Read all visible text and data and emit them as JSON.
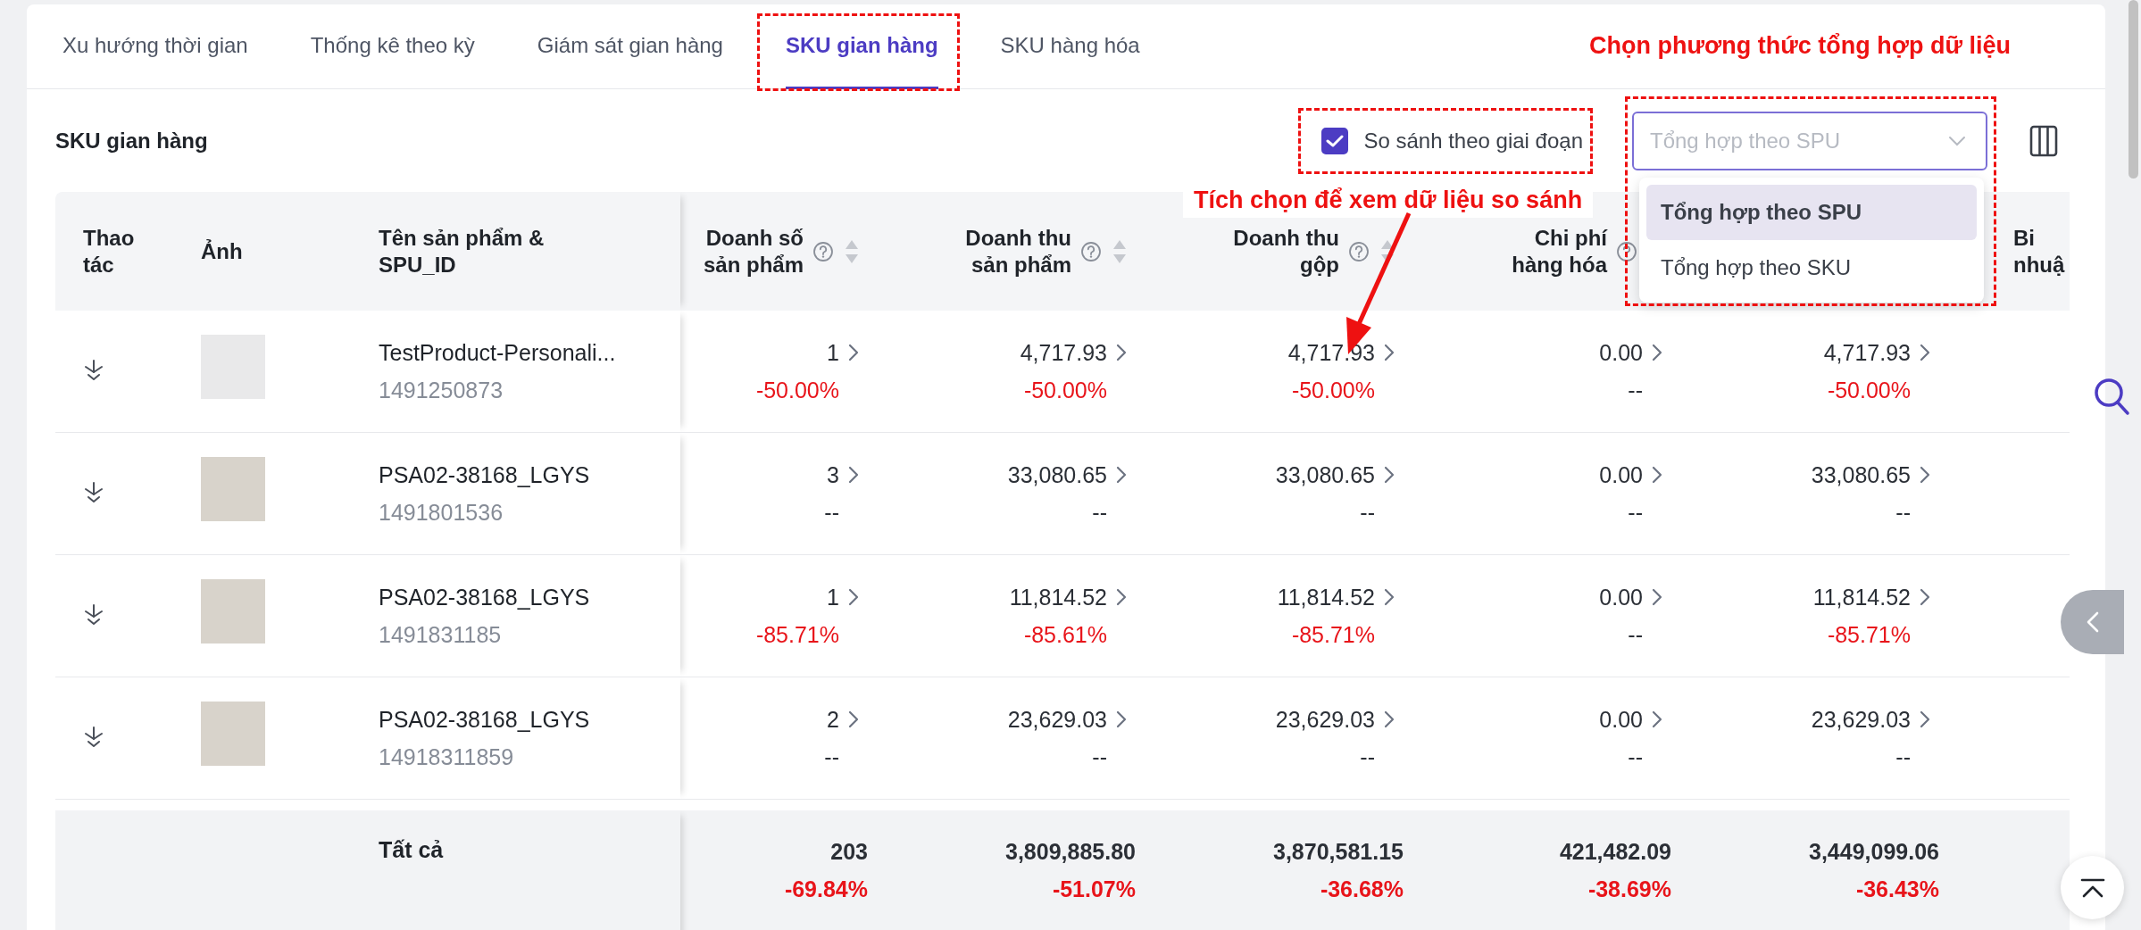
{
  "tabs": [
    {
      "label": "Xu hướng thời gian",
      "selected": false,
      "highlighted": false
    },
    {
      "label": "Thống kê theo kỳ",
      "selected": false,
      "highlighted": false
    },
    {
      "label": "Giám sát gian hàng",
      "selected": false,
      "highlighted": false
    },
    {
      "label": "SKU gian hàng",
      "selected": true,
      "highlighted": true
    },
    {
      "label": "SKU hàng hóa",
      "selected": false,
      "highlighted": false
    }
  ],
  "annotations": {
    "select_hint": "Chọn phương thức tổng hợp dữ liệu",
    "checkbox_hint": "Tích chọn để xem dữ liệu so sánh"
  },
  "toolbar": {
    "title": "SKU gian hàng",
    "compare": {
      "label": "So sánh theo giai đoạn",
      "checked": true,
      "highlighted": true
    },
    "aggregate": {
      "value": "Tổng hợp theo SPU",
      "open": true,
      "highlighted": true,
      "options": [
        {
          "label": "Tổng hợp theo SPU",
          "selected": true
        },
        {
          "label": "Tổng hợp theo SKU",
          "selected": false
        }
      ]
    }
  },
  "table": {
    "columns": [
      {
        "kind": "action",
        "label": "Thao\ntác"
      },
      {
        "kind": "image",
        "label": "Ảnh"
      },
      {
        "kind": "name",
        "label": "Tên sản phẩm &\nSPU_ID"
      },
      {
        "kind": "metric",
        "label": "Doanh số\nsản phẩm",
        "help": true,
        "sortable": true
      },
      {
        "kind": "metric",
        "label": "Doanh thu\nsản phẩm",
        "help": true,
        "sortable": true
      },
      {
        "kind": "metric",
        "label": "Doanh thu\ngộp",
        "help": true,
        "sortable": true
      },
      {
        "kind": "metric",
        "label": "Chi phí\nhàng hóa",
        "help": true,
        "sortable": false
      },
      {
        "kind": "metric"
      },
      {
        "kind": "cut",
        "label": "Bi\nnhuậ"
      }
    ],
    "rows": [
      {
        "cells": [
          "",
          "",
          {
            "name": "TestProduct-Personali...",
            "id": "1491250873"
          },
          {
            "value": "1",
            "change": "-50.00%",
            "color": "#e8141a"
          },
          {
            "value": "4,717.93",
            "change": "-50.00%",
            "color": "#e8141a"
          },
          {
            "value": "4,717.93",
            "change": "-50.00%",
            "color": "#e8141a"
          },
          {
            "value": "0.00",
            "change": "--",
            "color": "#2b2f36"
          },
          {
            "value": "4,717.93",
            "change": "-50.00%",
            "color": "#e8141a"
          },
          ""
        ]
      },
      {
        "cells": [
          "",
          "",
          {
            "name": "PSA02-38168_LGYS",
            "id": "1491801536"
          },
          {
            "value": "3",
            "change": "--",
            "color": "#2b2f36"
          },
          {
            "value": "33,080.65",
            "change": "--",
            "color": "#2b2f36"
          },
          {
            "value": "33,080.65",
            "change": "--",
            "color": "#2b2f36"
          },
          {
            "value": "0.00",
            "change": "--",
            "color": "#2b2f36"
          },
          {
            "value": "33,080.65",
            "change": "--",
            "color": "#2b2f36"
          },
          ""
        ]
      },
      {
        "cells": [
          "",
          "",
          {
            "name": "PSA02-38168_LGYS",
            "id": "1491831185"
          },
          {
            "value": "1",
            "change": "-85.71%",
            "color": "#e8141a"
          },
          {
            "value": "11,814.52",
            "change": "-85.61%",
            "color": "#e8141a"
          },
          {
            "value": "11,814.52",
            "change": "-85.71%",
            "color": "#e8141a"
          },
          {
            "value": "0.00",
            "change": "--",
            "color": "#2b2f36"
          },
          {
            "value": "11,814.52",
            "change": "-85.71%",
            "color": "#e8141a"
          },
          ""
        ]
      },
      {
        "cells": [
          "",
          "",
          {
            "name": "PSA02-38168_LGYS",
            "id": "14918311859"
          },
          {
            "value": "2",
            "change": "--",
            "color": "#2b2f36"
          },
          {
            "value": "23,629.03",
            "change": "--",
            "color": "#2b2f36"
          },
          {
            "value": "23,629.03",
            "change": "--",
            "color": "#2b2f36"
          },
          {
            "value": "0.00",
            "change": "--",
            "color": "#2b2f36"
          },
          {
            "value": "23,629.03",
            "change": "--",
            "color": "#2b2f36"
          },
          ""
        ]
      }
    ],
    "total": {
      "cells": [
        "",
        "",
        {
          "label": "Tất cả"
        },
        {
          "value": "203",
          "change": "-69.84%",
          "color": "#e8141a"
        },
        {
          "value": "3,809,885.80",
          "change": "-51.07%",
          "color": "#e8141a"
        },
        {
          "value": "3,870,581.15",
          "change": "-36.68%",
          "color": "#e8141a"
        },
        {
          "value": "421,482.09",
          "change": "-38.69%",
          "color": "#e8141a"
        },
        {
          "value": "3,449,099.06",
          "change": "-36.43%",
          "color": "#e8141a"
        },
        ""
      ]
    }
  }
}
